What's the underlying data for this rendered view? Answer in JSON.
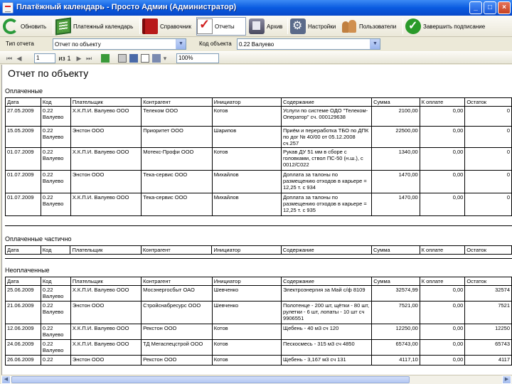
{
  "window": {
    "title": "Платёжный календарь - Просто Админ (Администратор)",
    "controls": [
      "_",
      "□",
      "×"
    ]
  },
  "toolbar": {
    "items": [
      {
        "label": "Обновить",
        "icon": "refresh-icon"
      },
      {
        "label": "Платежный календарь",
        "icon": "calendar-icon"
      },
      {
        "label": "Справочник",
        "icon": "book-icon"
      },
      {
        "label": "Отчеты",
        "icon": "report-icon",
        "active": true
      },
      {
        "label": "Архив",
        "icon": "archive-icon"
      },
      {
        "label": "Настройки",
        "icon": "settings-icon"
      },
      {
        "label": "Пользователи",
        "icon": "users-icon"
      },
      {
        "label": "Завершить подписание",
        "icon": "finish-icon"
      }
    ]
  },
  "filter": {
    "report_type_label": "Тип отчета",
    "report_type_value": "Отчет по объекту",
    "object_label": "Код объекта",
    "object_value": "0.22 Валуево"
  },
  "report_toolbar": {
    "page_current": "1",
    "page_of": "из",
    "page_total": "1",
    "zoom": "100%"
  },
  "report": {
    "title": "Отчет по объекту",
    "columns": [
      "Дата",
      "Код",
      "Плательщик",
      "Контрагент",
      "Инициатор",
      "Содержание",
      "Сумма",
      "К оплате",
      "Остаток"
    ],
    "sections": [
      {
        "title": "Оплаченные",
        "rows": [
          [
            "27.05.2009",
            "0.22 Валуево",
            "Х.К.П.И. Валуево ООО",
            "Телеком ООО",
            "Котов",
            "Услуги по системе ОДО \"Телеком-Оператор\" сч. 000129638",
            "2100,00",
            "0,00",
            "0"
          ],
          [
            "15.05.2009",
            "0.22 Валуево",
            "Энстон ООО",
            "Приоритет ООО",
            "Шарипов",
            "Приём и переработка ТБО по ДПК по дог № 40/00 от 05.12.2008 сч.257",
            "22500,00",
            "0,00",
            "0"
          ],
          [
            "01.07.2009",
            "0.22 Валуево",
            "Х.К.П.И. Валуево ООО",
            "Мотекс-Профи ООО",
            "Котов",
            "Рукав ДУ 51 мм в сборе с головками, ствол ПС-50 (н.ш.), с 0012/С022",
            "1340,00",
            "0,00",
            "0"
          ],
          [
            "01.07.2009",
            "0.22 Валуево",
            "Энстон ООО",
            "Тека-сервис ООО",
            "Михайлов",
            "Доплата за талоны по размещению отходов в карьере = 12,25 т. с 934",
            "1470,00",
            "0,00",
            "0"
          ],
          [
            "01.07.2009",
            "0.22 Валуево",
            "Х.К.П.И. Валуево ООО",
            "Тека-сервис ООО",
            "Михайлов",
            "Доплата за талоны по размещению отходов в карьере = 12,25 т. с 935",
            "1470,00",
            "0,00",
            "0"
          ]
        ]
      },
      {
        "title": "Оплаченные частично",
        "rows": []
      },
      {
        "title": "Неоплаченные",
        "rows": [
          [
            "25.06.2009",
            "0.22 Валуево",
            "Х.К.П.И. Валуево ООО",
            "Мосэнергосбыт ОАО",
            "Шевченко",
            "Электроэнергия за Май с/ф 8109",
            "32574,99",
            "0,00",
            "32574"
          ],
          [
            "21.06.2009",
            "0.22 Валуево",
            "Энстон ООО",
            "Стройснабресурс ООО",
            "Шевченко",
            "Полотенце - 200 шт, щётки - 80 шт, рулетки - 6 шт, лопаты - 10 шт сч 9906551",
            "7521,00",
            "0,00",
            "7521"
          ],
          [
            "12.06.2009",
            "0.22 Валуево",
            "Х.К.П.И. Валуево ООО",
            "Рекстон ООО",
            "Котов",
            "Щебень - 40 м3 сч 120",
            "12250,00",
            "0,00",
            "12250"
          ],
          [
            "24.06.2009",
            "0.22 Валуево",
            "Х.К.П.И. Валуево ООО",
            "ТД Мегаспецстрой ООО",
            "Котов",
            "Пескосмесь - 315 м3 сч 4850",
            "65743,00",
            "0,00",
            "65743"
          ],
          [
            "26.06.2009",
            "0.22",
            "Энстон ООО",
            "Рекстон ООО",
            "Котов",
            "Щебень - 3,167 м3 сч 131",
            "4117,10",
            "0,00",
            "4117"
          ]
        ]
      }
    ]
  }
}
